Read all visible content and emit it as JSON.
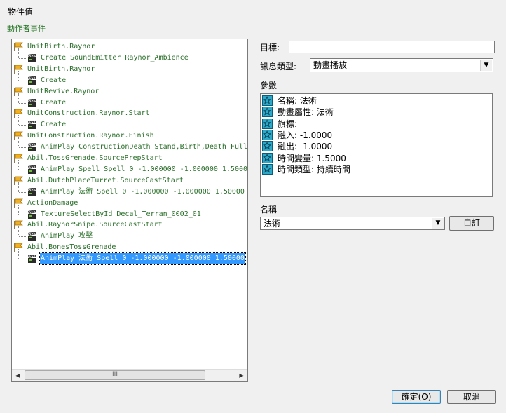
{
  "window": {
    "title": "物件值"
  },
  "actor_events_link": "動作者事件",
  "tree": {
    "rows": [
      {
        "text": "UnitBirth.Raynor",
        "kind": "event"
      },
      {
        "text": "Create SoundEmitter Raynor_Ambience",
        "kind": "action"
      },
      {
        "text": "UnitBirth.Raynor",
        "kind": "event"
      },
      {
        "text": "Create",
        "kind": "action"
      },
      {
        "text": "UnitRevive.Raynor",
        "kind": "event"
      },
      {
        "text": "Create",
        "kind": "action"
      },
      {
        "text": "UnitConstruction.Raynor.Start",
        "kind": "event"
      },
      {
        "text": "Create",
        "kind": "action"
      },
      {
        "text": "UnitConstruction.Raynor.Finish",
        "kind": "event"
      },
      {
        "text": "AnimPlay ConstructionDeath Stand,Birth,Death Full",
        "kind": "action"
      },
      {
        "text": "Abil.TossGrenade.SourcePrepStart",
        "kind": "event"
      },
      {
        "text": "AnimPlay Spell Spell 0 -1.000000 -1.000000 1.5000",
        "kind": "action"
      },
      {
        "text": "Abil.DutchPlaceTurret.SourceCastStart",
        "kind": "event"
      },
      {
        "text": "AnimPlay 法術 Spell 0 -1.000000 -1.000000 1.50000",
        "kind": "action"
      },
      {
        "text": "ActionDamage",
        "kind": "event"
      },
      {
        "text": "TextureSelectById Decal_Terran_0002_01",
        "kind": "action"
      },
      {
        "text": "Abil.RaynorSnipe.SourceCastStart",
        "kind": "event"
      },
      {
        "text": "AnimPlay 攻擊",
        "kind": "action"
      },
      {
        "text": "Abil.BonesTossGrenade",
        "kind": "event"
      },
      {
        "text": "AnimPlay 法術 Spell 0 -1.000000 -1.000000 1.50000",
        "kind": "action",
        "selected": true
      }
    ],
    "scroll_thumb_label": "III"
  },
  "target": {
    "label": "目標:",
    "value": ""
  },
  "message_type": {
    "label": "訊息類型:",
    "value": "動畫播放"
  },
  "params": {
    "label": "參數",
    "items": [
      "名稱: 法術",
      "動畫屬性: 法術",
      "旗標:",
      "融入: -1.0000",
      "融出: -1.0000",
      "時間變量: 1.5000",
      "時間類型: 持續時間"
    ]
  },
  "name_field": {
    "label": "名稱",
    "value": "法術",
    "custom_button": "自訂"
  },
  "buttons": {
    "ok": "確定(O)",
    "cancel": "取消"
  },
  "colors": {
    "selection": "#3399ff",
    "event_text": "#2a6f2a",
    "icon_teal": "#2aa9c9"
  }
}
